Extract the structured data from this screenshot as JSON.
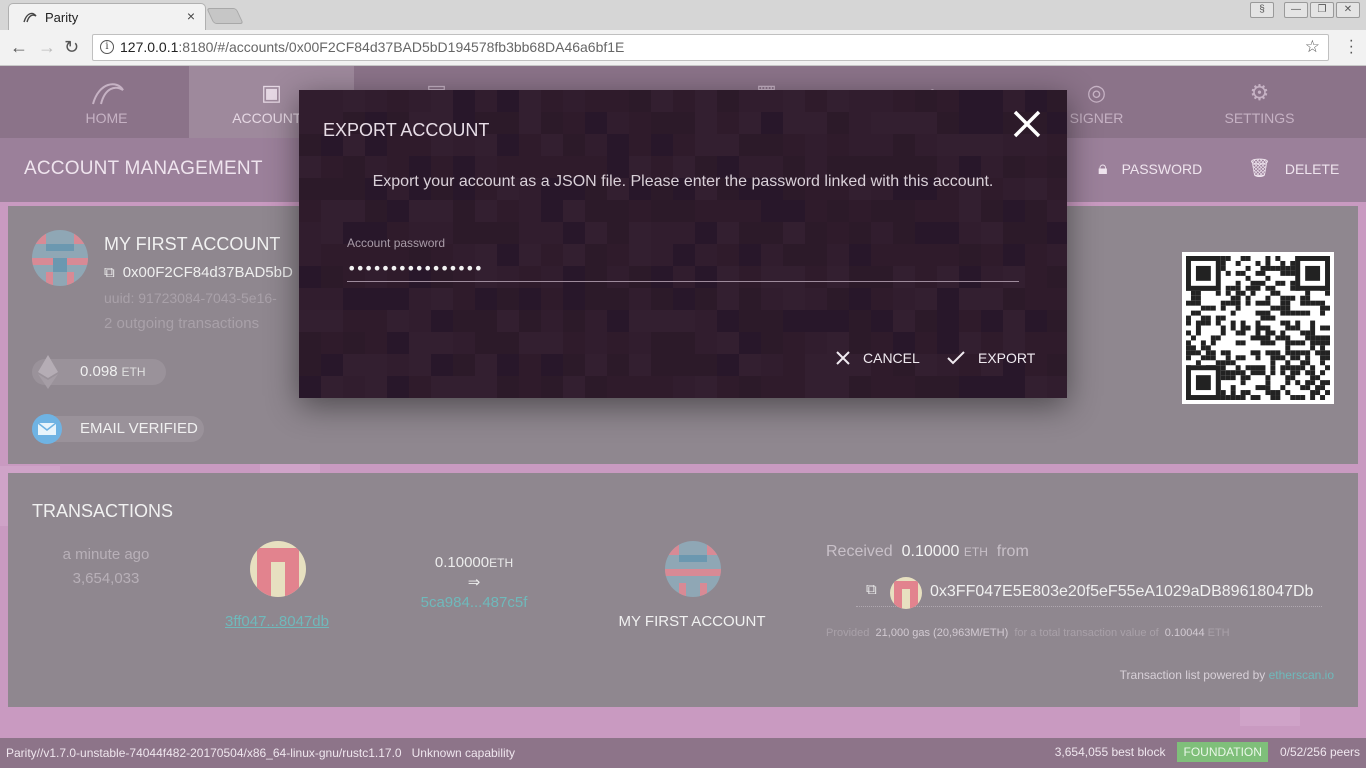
{
  "browser": {
    "tab_title": "Parity",
    "tab_close": "×",
    "url_host": "127.0.0.1",
    "url_rest": ":8180/#/accounts/0x00F2CF84d37BAD5bD194578fb3bb68DA46a6bf1E"
  },
  "nav": {
    "home": "HOME",
    "accounts": "ACCOUNTS",
    "signer": "SIGNER",
    "settings": "SETTINGS"
  },
  "page": {
    "title": "ACCOUNT MANAGEMENT",
    "password_action": "PASSWORD",
    "delete_action": "DELETE"
  },
  "account": {
    "name": "MY FIRST ACCOUNT",
    "address": "0x00F2CF84d37BAD5bD",
    "uuid": "uuid: 91723084-7043-5e16-",
    "tx_count": "2 outgoing transactions",
    "balance": "0.098",
    "balance_unit": "ETH",
    "email": "EMAIL VERIFIED"
  },
  "transactions": {
    "title": "TRANSACTIONS",
    "time": "a minute ago",
    "block": "3,654,033",
    "from_short": "3ff047...8047db",
    "amount": "0.10000",
    "amount_unit": "ETH",
    "arrow": "⇒",
    "to_short": "5ca984...487c5f",
    "to_name": "MY FIRST ACCOUNT",
    "received_label": "Received",
    "received_value": "0.10000",
    "received_unit": "ETH",
    "received_from": "from",
    "sender_address": "0x3FF047E5E803e20f5eF55eA1029aDB89618047Db",
    "gas_provided": "Provided",
    "gas_value": "21,000 gas (20,963M/ETH)",
    "gas_mid": "for a total transaction value of",
    "gas_total": "0.10044",
    "gas_unit": "ETH",
    "powered_by": "Transaction list powered by",
    "powered_link": "etherscan.io"
  },
  "status": {
    "version": "Parity//v1.7.0-unstable-74044f482-20170504/x86_64-linux-gnu/rustc1.17.0",
    "capability": "Unknown capability",
    "block": "3,654,055 best block",
    "chain": "FOUNDATION",
    "peers": "0/52/256 peers"
  },
  "modal": {
    "title": "EXPORT ACCOUNT",
    "description": "Export your account as a JSON file. Please enter the password linked with this account.",
    "password_label": "Account password",
    "password_value": "••••••••••••••••",
    "cancel": "CANCEL",
    "export": "EXPORT"
  },
  "colors": {
    "accent_link": "#6fb9bb",
    "badge": "#7fbf7a",
    "modal_bg": "#2c1a29"
  }
}
